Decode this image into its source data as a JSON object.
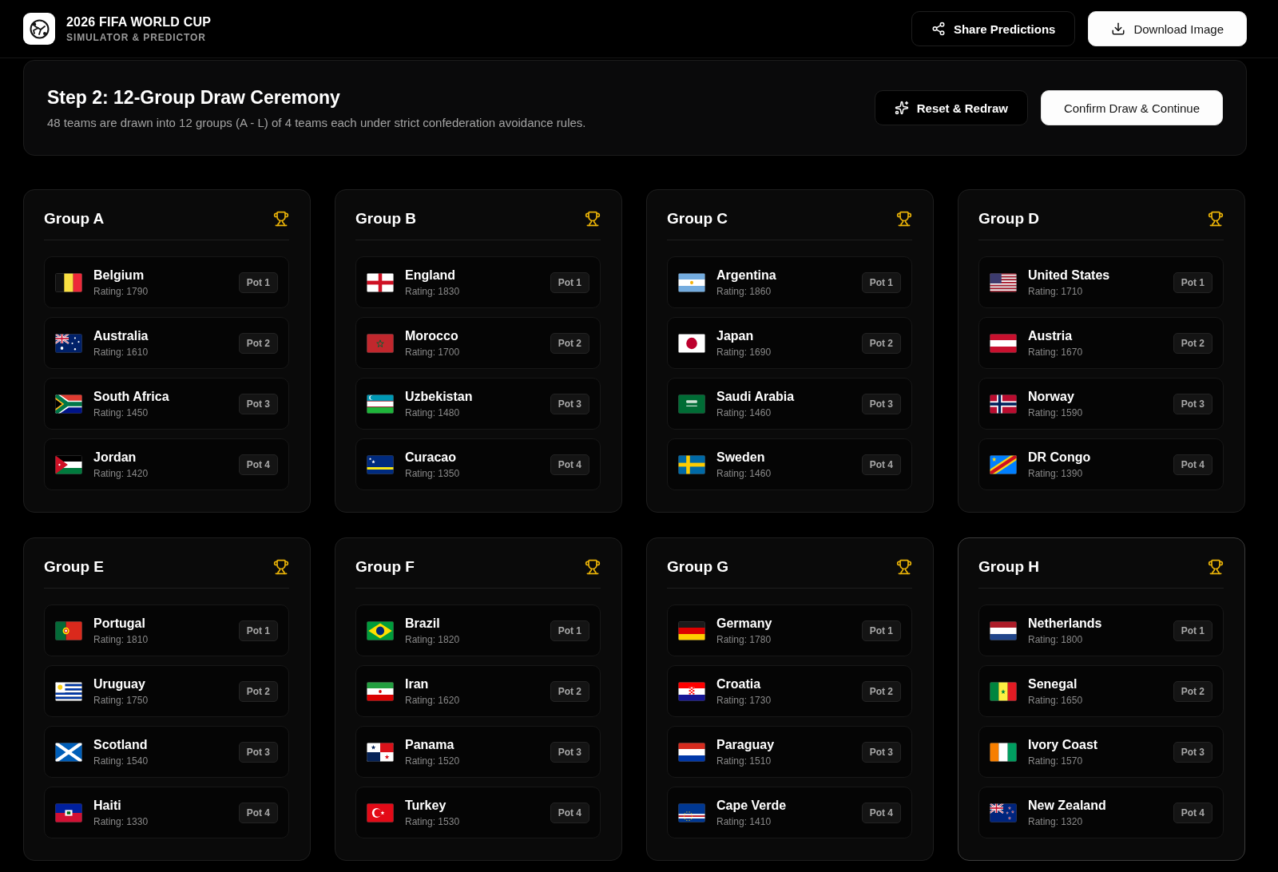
{
  "header": {
    "title": "2026 FIFA WORLD CUP",
    "subtitle": "SIMULATOR & PREDICTOR",
    "buttons": [
      {
        "label": "Share Predictions",
        "kind": "share"
      },
      {
        "label": "Download Image",
        "kind": "download"
      }
    ]
  },
  "step": {
    "title": "Step 2: 12-Group Draw Ceremony",
    "description": "48 teams are drawn into 12 groups (A - L) of 4 teams each under strict confederation avoidance rules.",
    "buttons": [
      {
        "label": "Reset & Redraw",
        "kind": "redraw"
      },
      {
        "label": "Confirm Draw & Continue",
        "kind": "confirm"
      }
    ]
  },
  "groups": [
    {
      "name": "Group A",
      "highlighted": false,
      "teams": [
        {
          "name": "Belgium",
          "rating": "Rating: 1790",
          "pot": "Pot 1",
          "kind": "be"
        },
        {
          "name": "Australia",
          "rating": "Rating: 1610",
          "pot": "Pot 2",
          "kind": "au"
        },
        {
          "name": "South Africa",
          "rating": "Rating: 1450",
          "pot": "Pot 3",
          "kind": "za"
        },
        {
          "name": "Jordan",
          "rating": "Rating: 1420",
          "pot": "Pot 4",
          "kind": "jo"
        }
      ]
    },
    {
      "name": "Group B",
      "highlighted": false,
      "teams": [
        {
          "name": "England",
          "rating": "Rating: 1830",
          "pot": "Pot 1",
          "kind": "eng"
        },
        {
          "name": "Morocco",
          "rating": "Rating: 1700",
          "pot": "Pot 2",
          "kind": "ma"
        },
        {
          "name": "Uzbekistan",
          "rating": "Rating: 1480",
          "pot": "Pot 3",
          "kind": "uz"
        },
        {
          "name": "Curacao",
          "rating": "Rating: 1350",
          "pot": "Pot 4",
          "kind": "cw"
        }
      ]
    },
    {
      "name": "Group C",
      "highlighted": false,
      "teams": [
        {
          "name": "Argentina",
          "rating": "Rating: 1860",
          "pot": "Pot 1",
          "kind": "ar"
        },
        {
          "name": "Japan",
          "rating": "Rating: 1690",
          "pot": "Pot 2",
          "kind": "jp"
        },
        {
          "name": "Saudi Arabia",
          "rating": "Rating: 1460",
          "pot": "Pot 3",
          "kind": "sa"
        },
        {
          "name": "Sweden",
          "rating": "Rating: 1460",
          "pot": "Pot 4",
          "kind": "se"
        }
      ]
    },
    {
      "name": "Group D",
      "highlighted": false,
      "teams": [
        {
          "name": "United States",
          "rating": "Rating: 1710",
          "pot": "Pot 1",
          "kind": "us"
        },
        {
          "name": "Austria",
          "rating": "Rating: 1670",
          "pot": "Pot 2",
          "kind": "at"
        },
        {
          "name": "Norway",
          "rating": "Rating: 1590",
          "pot": "Pot 3",
          "kind": "no"
        },
        {
          "name": "DR Congo",
          "rating": "Rating: 1390",
          "pot": "Pot 4",
          "kind": "cd"
        }
      ]
    },
    {
      "name": "Group E",
      "highlighted": false,
      "teams": [
        {
          "name": "Portugal",
          "rating": "Rating: 1810",
          "pot": "Pot 1",
          "kind": "pt"
        },
        {
          "name": "Uruguay",
          "rating": "Rating: 1750",
          "pot": "Pot 2",
          "kind": "uy"
        },
        {
          "name": "Scotland",
          "rating": "Rating: 1540",
          "pot": "Pot 3",
          "kind": "sct"
        },
        {
          "name": "Haiti",
          "rating": "Rating: 1330",
          "pot": "Pot 4",
          "kind": "ht"
        }
      ]
    },
    {
      "name": "Group F",
      "highlighted": false,
      "teams": [
        {
          "name": "Brazil",
          "rating": "Rating: 1820",
          "pot": "Pot 1",
          "kind": "br"
        },
        {
          "name": "Iran",
          "rating": "Rating: 1620",
          "pot": "Pot 2",
          "kind": "ir"
        },
        {
          "name": "Panama",
          "rating": "Rating: 1520",
          "pot": "Pot 3",
          "kind": "pa"
        },
        {
          "name": "Turkey",
          "rating": "Rating: 1530",
          "pot": "Pot 4",
          "kind": "tr"
        }
      ]
    },
    {
      "name": "Group G",
      "highlighted": false,
      "teams": [
        {
          "name": "Germany",
          "rating": "Rating: 1780",
          "pot": "Pot 1",
          "kind": "de"
        },
        {
          "name": "Croatia",
          "rating": "Rating: 1730",
          "pot": "Pot 2",
          "kind": "hr"
        },
        {
          "name": "Paraguay",
          "rating": "Rating: 1510",
          "pot": "Pot 3",
          "kind": "py"
        },
        {
          "name": "Cape Verde",
          "rating": "Rating: 1410",
          "pot": "Pot 4",
          "kind": "cv"
        }
      ]
    },
    {
      "name": "Group H",
      "highlighted": true,
      "teams": [
        {
          "name": "Netherlands",
          "rating": "Rating: 1800",
          "pot": "Pot 1",
          "kind": "nl"
        },
        {
          "name": "Senegal",
          "rating": "Rating: 1650",
          "pot": "Pot 2",
          "kind": "sn"
        },
        {
          "name": "Ivory Coast",
          "rating": "Rating: 1570",
          "pot": "Pot 3",
          "kind": "ci"
        },
        {
          "name": "New Zealand",
          "rating": "Rating: 1320",
          "pot": "Pot 4",
          "kind": "nz"
        }
      ]
    }
  ]
}
